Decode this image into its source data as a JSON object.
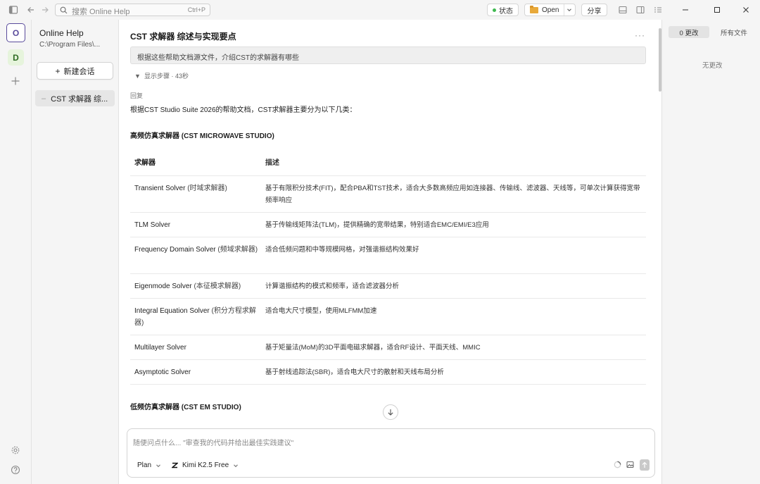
{
  "titlebar": {
    "search_placeholder": "搜索 Online Help",
    "search_shortcut": "Ctrl+P",
    "status_label": "状态",
    "open_label": "Open",
    "share_label": "分享"
  },
  "rail": {
    "workspaces": [
      {
        "letter": "O",
        "selected": true
      },
      {
        "letter": "D",
        "selected": false
      }
    ]
  },
  "sidebar": {
    "project_title": "Online Help",
    "project_path": "C:\\Program Files\\...",
    "new_session_label": "新建会话",
    "sessions": [
      {
        "title": "CST 求解器 综..."
      }
    ]
  },
  "main": {
    "title": "CST 求解器 综述与实现要点",
    "more_label": "···",
    "user_prompt": "根据这些帮助文档源文件，介绍CST的求解器有哪些",
    "steps_label": "显示步骤",
    "steps_time": "43秒",
    "reply_label": "回复",
    "reply_intro": "根据CST Studio Suite 2026的帮助文档，CST求解器主要分为以下几类：",
    "section1_title": "高频仿真求解器 (CST MICROWAVE STUDIO)",
    "section2_title": "低频仿真求解器 (CST EM STUDIO)",
    "table": {
      "headers": [
        "求解器",
        "描述"
      ],
      "rows": [
        {
          "name": "Transient Solver",
          "cn": "(时域求解器)",
          "desc": "基于有限积分技术(FIT)，配合PBA和TST技术，适合大多数高频应用如连接器、传输线、滤波器、天线等，可单次计算获得宽带频率响应"
        },
        {
          "name": "TLM Solver",
          "cn": "",
          "desc": "基于传输线矩阵法(TLM)，提供精确的宽带结果，特别适合EMC/EMI/E3应用"
        },
        {
          "name": "Frequency Domain Solver",
          "cn": "(频域求解器)",
          "desc": "适合低频问题和中等规模网格，对强谐振结构效果好"
        },
        {
          "name": "Eigenmode Solver",
          "cn": "(本征模求解器)",
          "desc": "计算谐振结构的模式和频率，适合滤波器分析"
        },
        {
          "name": "Integral Equation Solver",
          "cn": "(积分方程求解器)",
          "desc": "适合电大尺寸模型，使用MLFMM加速"
        },
        {
          "name": "Multilayer Solver",
          "cn": "",
          "desc": "基于矩量法(MoM)的3D平面电磁求解器，适合RF设计、平面天线、MMIC"
        },
        {
          "name": "Asymptotic Solver",
          "cn": "",
          "desc": "基于射线追踪法(SBR)，适合电大尺寸的散射和天线布局分析"
        }
      ]
    },
    "composer": {
      "placeholder": "随便问点什么... \"审查我的代码并给出最佳实践建议\"",
      "mode_label": "Plan",
      "model_label": "Kimi K2.5 Free"
    }
  },
  "right_panel": {
    "tab_changes": "0 更改",
    "tab_all_files": "所有文件",
    "empty_text": "无更改"
  },
  "colors": {
    "accent": "#5a4b9c",
    "status_ok": "#3fb950",
    "workspace_d_bg": "#e6f4dc"
  }
}
